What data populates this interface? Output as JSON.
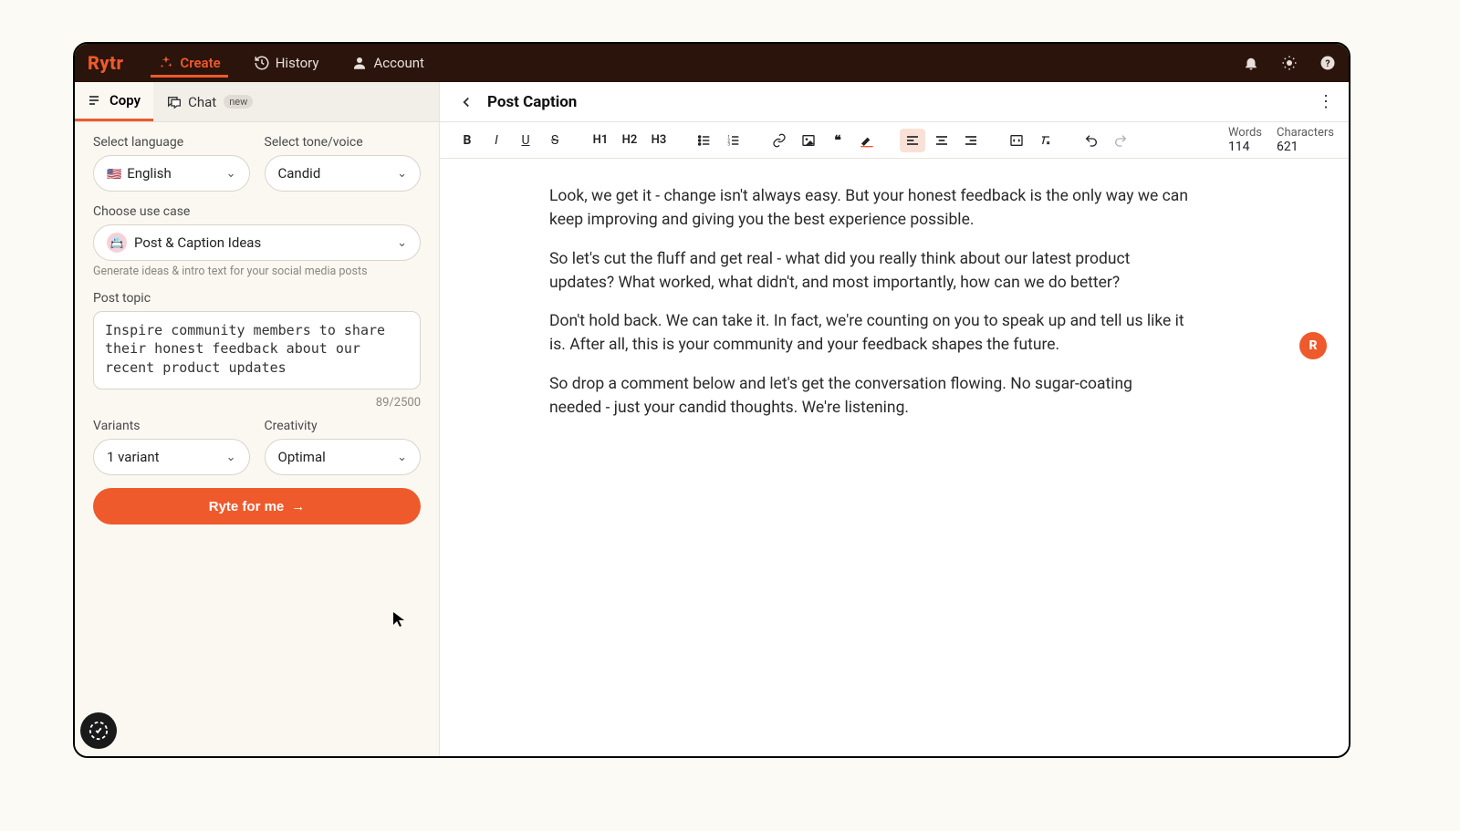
{
  "header": {
    "logo": "Rytr",
    "nav": {
      "create": "Create",
      "history": "History",
      "account": "Account"
    }
  },
  "tabs": {
    "copy": "Copy",
    "chat": "Chat",
    "chat_badge": "new"
  },
  "panel": {
    "language_label": "Select language",
    "language_value": "English",
    "language_flag": "🇺🇸",
    "tone_label": "Select tone/voice",
    "tone_value": "Candid",
    "usecase_label": "Choose use case",
    "usecase_value": "Post & Caption Ideas",
    "usecase_hint": "Generate ideas & intro text for your social media posts",
    "topic_label": "Post topic",
    "topic_value": "Inspire community members to share their honest feedback about our recent product updates",
    "topic_counter": "89/2500",
    "variants_label": "Variants",
    "variants_value": "1 variant",
    "creativity_label": "Creativity",
    "creativity_value": "Optimal",
    "cta": "Ryte for me"
  },
  "doc": {
    "title": "Post Caption",
    "toolbar": {
      "h1": "H1",
      "h2": "H2",
      "h3": "H3"
    },
    "stats": {
      "words_label": "Words",
      "words_value": "114",
      "chars_label": "Characters",
      "chars_value": "621"
    },
    "paragraphs": [
      "Look, we get it - change isn't always easy. But your honest feedback is the only way we can keep improving and giving you the best experience possible.",
      "So let's cut the fluff and get real - what did you really think about our latest product updates? What worked, what didn't, and most importantly, how can we do better?",
      "Don't hold back. We can take it. In fact, we're counting on you to speak up and tell us like it is. After all, this is your community and your feedback shapes the future.",
      "So drop a comment below and let's get the conversation flowing. No sugar-coating needed - just your candid thoughts. We're listening."
    ],
    "fab": "R"
  }
}
